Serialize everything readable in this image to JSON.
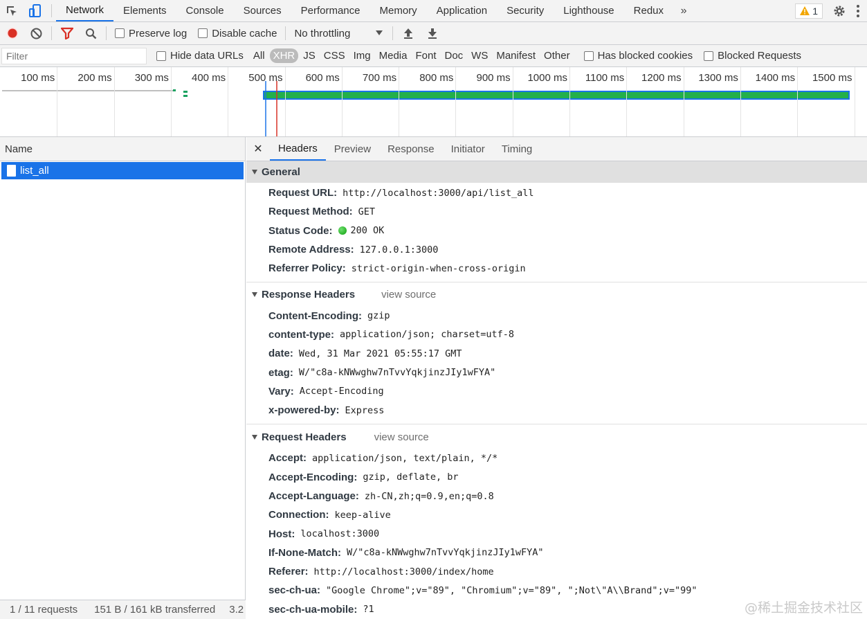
{
  "topbar": {
    "tabs": [
      "Network",
      "Elements",
      "Console",
      "Sources",
      "Performance",
      "Memory",
      "Application",
      "Security",
      "Lighthouse",
      "Redux"
    ],
    "more_icon": "chevron-double-right",
    "warning_count": "1"
  },
  "toolbar": {
    "preserve_log": "Preserve log",
    "disable_cache": "Disable cache",
    "throttling": "No throttling"
  },
  "filterbar": {
    "placeholder": "Filter",
    "hide_data_urls": "Hide data URLs",
    "types": [
      "All",
      "XHR",
      "JS",
      "CSS",
      "Img",
      "Media",
      "Font",
      "Doc",
      "WS",
      "Manifest",
      "Other"
    ],
    "selected_type": "XHR",
    "has_blocked_cookies": "Has blocked cookies",
    "blocked_requests": "Blocked Requests"
  },
  "overview": {
    "ticks": [
      "100 ms",
      "200 ms",
      "300 ms",
      "400 ms",
      "500 ms",
      "600 ms",
      "700 ms",
      "800 ms",
      "900 ms",
      "1000 ms",
      "1100 ms",
      "1200 ms",
      "1300 ms",
      "1400 ms",
      "1500 ms"
    ]
  },
  "list": {
    "header": "Name",
    "rows": [
      "list_all"
    ],
    "status_requests": "1 / 11 requests",
    "status_transferred": "151 B / 161 kB transferred",
    "status_extra": "3.2"
  },
  "details": {
    "tabs": [
      "Headers",
      "Preview",
      "Response",
      "Initiator",
      "Timing"
    ],
    "general": {
      "title": "General",
      "rows": [
        {
          "k": "Request URL:",
          "v": "http://localhost:3000/api/list_all"
        },
        {
          "k": "Request Method:",
          "v": "GET"
        },
        {
          "k": "Status Code:",
          "v": "200 OK"
        },
        {
          "k": "Remote Address:",
          "v": "127.0.0.1:3000"
        },
        {
          "k": "Referrer Policy:",
          "v": "strict-origin-when-cross-origin"
        }
      ]
    },
    "response_headers": {
      "title": "Response Headers",
      "view_source": "view source",
      "rows": [
        {
          "k": "Content-Encoding:",
          "v": "gzip"
        },
        {
          "k": "content-type:",
          "v": "application/json; charset=utf-8"
        },
        {
          "k": "date:",
          "v": "Wed, 31 Mar 2021 05:55:17 GMT"
        },
        {
          "k": "etag:",
          "v": "W/\"c8a-kNWwghw7nTvvYqkjinzJIy1wFYA\""
        },
        {
          "k": "Vary:",
          "v": "Accept-Encoding"
        },
        {
          "k": "x-powered-by:",
          "v": "Express"
        }
      ]
    },
    "request_headers": {
      "title": "Request Headers",
      "view_source": "view source",
      "rows": [
        {
          "k": "Accept:",
          "v": "application/json, text/plain, */*"
        },
        {
          "k": "Accept-Encoding:",
          "v": "gzip, deflate, br"
        },
        {
          "k": "Accept-Language:",
          "v": "zh-CN,zh;q=0.9,en;q=0.8"
        },
        {
          "k": "Connection:",
          "v": "keep-alive"
        },
        {
          "k": "Host:",
          "v": "localhost:3000"
        },
        {
          "k": "If-None-Match:",
          "v": "W/\"c8a-kNWwghw7nTvvYqkjinzJIy1wFYA\""
        },
        {
          "k": "Referer:",
          "v": "http://localhost:3000/index/home"
        },
        {
          "k": "sec-ch-ua:",
          "v": "\"Google Chrome\";v=\"89\", \"Chromium\";v=\"89\", \";Not\\\"A\\\\Brand\";v=\"99\""
        },
        {
          "k": "sec-ch-ua-mobile:",
          "v": "?1"
        }
      ]
    }
  },
  "watermark": "@稀土掘金技术社区"
}
